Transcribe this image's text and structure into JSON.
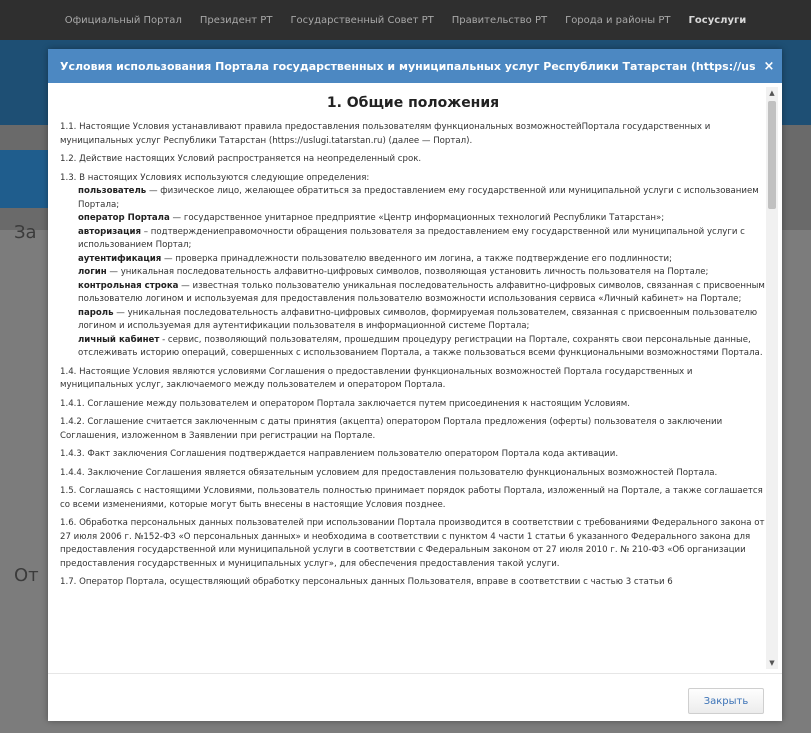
{
  "topnav": {
    "items": [
      "Официальный Портал",
      "Президент РТ",
      "Государственный Совет РТ",
      "Правительство РТ",
      "Города и районы РТ",
      "Госуслуги"
    ]
  },
  "background": {
    "fragment_1": "За",
    "fragment_2": "От"
  },
  "modal": {
    "title": "Условия использования Портала государственных и муниципальных услуг Республики Татарстан (https://uslugi.tatarstan.ru)",
    "close_symbol": "×",
    "section_title": "1. Общие положения",
    "paragraphs_before": [
      "1.1. Настоящие Условия устанавливают правила предоставления пользователям функциональных возможностейПортала государственных и муниципальных услуг Республики Татарстан (https://uslugi.tatarstan.ru) (далее — Портал).",
      "1.2. Действие настоящих Условий распространяется на неопределенный срок.",
      "1.3. В настоящих Условиях используются следующие определения:"
    ],
    "definitions": [
      {
        "term": "пользователь",
        "text": " — физическое лицо, желающее обратиться за предоставлением ему государственной или муниципальной услуги с использованием Портала;"
      },
      {
        "term": "оператор Портала",
        "text": " — государственное унитарное предприятие «Центр информационных технологий Республики Татарстан»;"
      },
      {
        "term": "авторизация",
        "text": " – подтверждениеправомочности обращения пользователя за предоставлением ему государственной или муниципальной услуги с использованием Портал;"
      },
      {
        "term": "аутентификация",
        "text": " — проверка принадлежности пользователю введенного им логина, а также подтверждение его подлинности;"
      },
      {
        "term": "логин",
        "text": " — уникальная последовательность алфавитно-цифровых символов, позволяющая установить личность пользователя на Портале;"
      },
      {
        "term": "контрольная строка",
        "text": " — известная только пользователю уникальная последовательность алфавитно-цифровых символов, связанная с присвоенным пользователю логином и используемая для предоставления пользователю возможности использования сервиса «Личный кабинет» на Портале;"
      },
      {
        "term": "пароль",
        "text": " — уникальная последовательность алфавитно-цифровых символов, формируемая пользователем, связанная с присвоенным пользователю логином и используемая для аутентификации пользователя в информационной системе Портала;"
      },
      {
        "term": "личный кабинет",
        "text": " - сервис, позволяющий пользователям, прошедшим процедуру регистрации на Портале, сохранять свои персональные данные, отслеживать историю операций, совершенных с использованием Портала, а также пользоваться всеми функциональными возможностями Портала."
      }
    ],
    "paragraphs_after": [
      "1.4. Настоящие Условия являются условиями Соглашения о предоставлении функциональных возможностей Портала государственных и муниципальных услуг, заключаемого между пользователем и оператором Портала.",
      "1.4.1. Соглашение между пользователем и оператором Портала заключается путем присоединения к настоящим Условиям.",
      "1.4.2. Соглашение считается заключенным с даты принятия (акцепта) оператором Портала предложения (оферты) пользователя о заключении Соглашения, изложенном в Заявлении при регистрации на Портале.",
      "1.4.3. Факт заключения Соглашения подтверждается направлением пользователю оператором Портала кода активации.",
      "1.4.4. Заключение Соглашения является обязательным условием для предоставления пользователю функциональных возможностей Портала.",
      "1.5. Соглашаясь с настоящими Условиями, пользователь полностью принимает порядок работы Портала, изложенный на Портале, а также соглашается со всеми изменениями, которые могут быть внесены в настоящие Условия позднее.",
      "1.6. Обработка персональных данных пользователей при использовании Портала производится в соответствии с требованиями Федерального закона от 27 июля 2006 г. №152-ФЗ «О персональных данных» и необходима в соответствии с пунктом 4 части 1 статьи 6 указанного Федерального закона для предоставления государственной или муниципальной услуги в соответствии с Федеральным законом от 27 июля 2010 г. № 210-ФЗ «Об организации предоставления государственных и муниципальных услуг», для обеспечения предоставления такой услуги.",
      "1.7. Оператор Портала, осуществляющий обработку персональных данных Пользователя, вправе в соответствии с частью 3 статьи 6"
    ],
    "footer": {
      "close_label": "Закрыть"
    }
  },
  "colors": {
    "header_blue": "#4c88c2",
    "button_text": "#3b72b6",
    "overlay": "#7a7a7a"
  }
}
